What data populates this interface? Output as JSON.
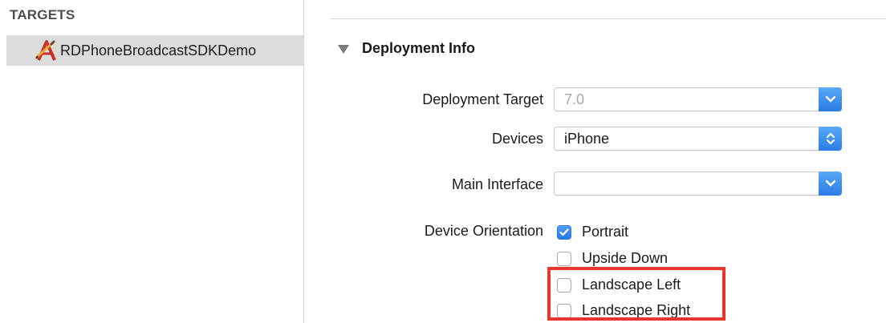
{
  "sidebar": {
    "header": "TARGETS",
    "target": {
      "label": "RDPhoneBroadcastSDKDemo",
      "icon": "app-target-icon"
    }
  },
  "deployment": {
    "title": "Deployment Info",
    "deployment_target": {
      "label": "Deployment Target",
      "value": "7.0"
    },
    "devices": {
      "label": "Devices",
      "value": "iPhone"
    },
    "main_interface": {
      "label": "Main Interface",
      "value": ""
    },
    "device_orientation": {
      "label": "Device Orientation",
      "options": [
        {
          "label": "Portrait",
          "checked": true
        },
        {
          "label": "Upside Down",
          "checked": false
        },
        {
          "label": "Landscape Left",
          "checked": false
        },
        {
          "label": "Landscape Right",
          "checked": false
        }
      ]
    }
  },
  "colors": {
    "accent": "#2a7de6",
    "highlight": "#e8352e",
    "selection": "#dcdcdc"
  }
}
